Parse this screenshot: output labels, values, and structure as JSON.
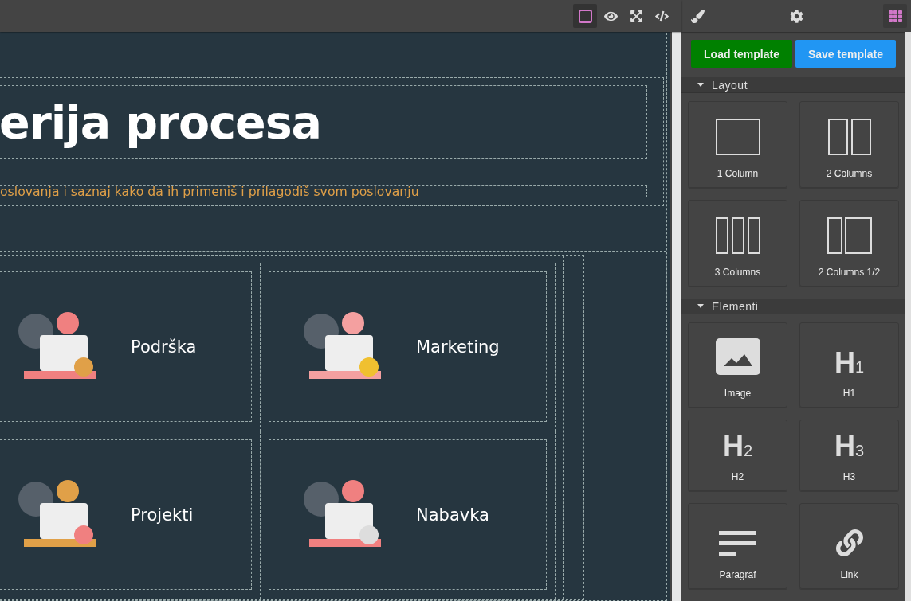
{
  "canvas_toolbar": [
    {
      "kind": "outline",
      "selected": true
    },
    {
      "kind": "preview",
      "selected": false
    },
    {
      "kind": "fullscreen",
      "selected": false
    },
    {
      "kind": "code",
      "selected": false
    }
  ],
  "panel_tabs": [
    {
      "kind": "style",
      "selected": false
    },
    {
      "kind": "settings",
      "selected": false
    },
    {
      "kind": "blocks",
      "selected": true
    }
  ],
  "canvas": {
    "heading": "erija procesa",
    "subtitle": "oslovanja i saznaj kako da ih primeniš i prilagodiš svom poslovanju",
    "cards": [
      {
        "label": "Podrška",
        "kind": "support"
      },
      {
        "label": "Marketing",
        "kind": "marketing"
      },
      {
        "label": "Projekti",
        "kind": "projects"
      },
      {
        "label": "Nabavka",
        "kind": "purchasing"
      }
    ]
  },
  "template_buttons": [
    {
      "label": "Load template",
      "kind": "load"
    },
    {
      "label": "Save template",
      "kind": "save"
    }
  ],
  "block_categories": [
    {
      "title": "Layout",
      "expanded": true,
      "blocks": [
        {
          "label": "1 Column",
          "kind": "col1"
        },
        {
          "label": "2 Columns",
          "kind": "col2"
        },
        {
          "label": "3 Columns",
          "kind": "col3"
        },
        {
          "label": "2 Columns 1/2",
          "kind": "col12"
        }
      ]
    },
    {
      "title": "Elementi",
      "expanded": true,
      "blocks": [
        {
          "label": "Image",
          "kind": "image"
        },
        {
          "label": "H1",
          "kind": "heading",
          "glyph": "H",
          "level": "1"
        },
        {
          "label": "H2",
          "kind": "heading",
          "glyph": "H",
          "level": "2"
        },
        {
          "label": "H3",
          "kind": "heading",
          "glyph": "H",
          "level": "3"
        },
        {
          "label": "Paragraf",
          "kind": "paragraph"
        },
        {
          "label": "Link",
          "kind": "link"
        }
      ]
    }
  ]
}
